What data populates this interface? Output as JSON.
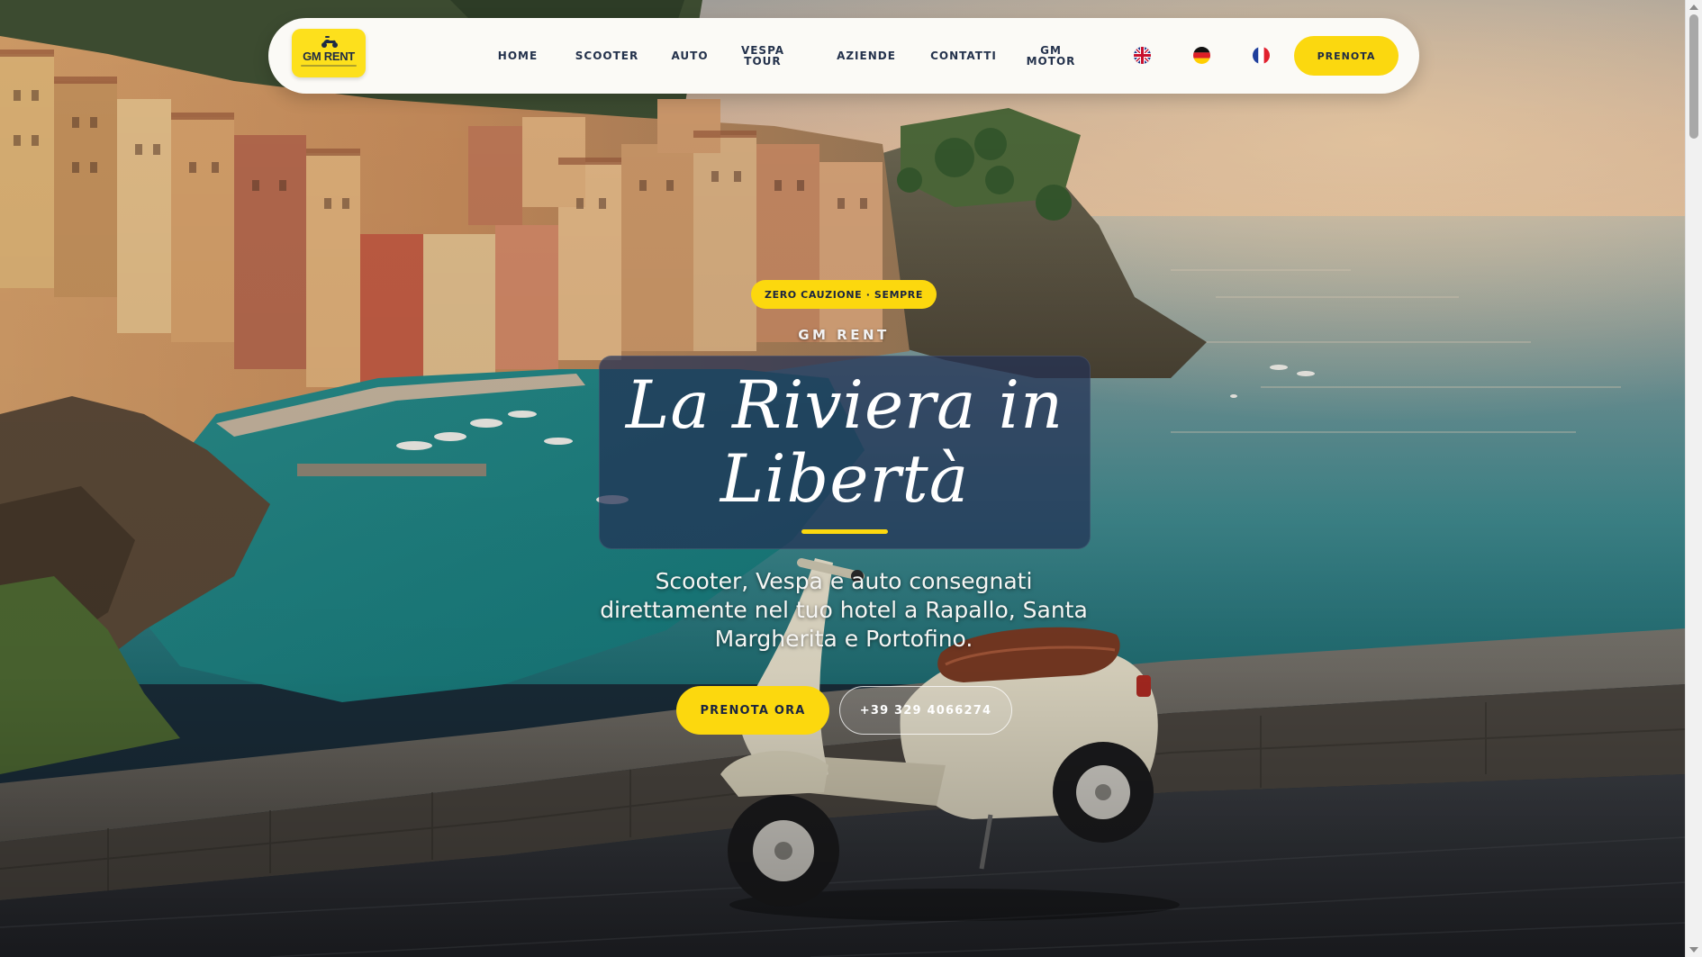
{
  "colors": {
    "accent": "#fcd80e",
    "navy": "#1e2b45",
    "navbar_bg": "#fbfaf6",
    "title_panel": "#223054"
  },
  "hero_image": "Riviera harbour town at sunset with a cream vintage scooter parked on a stone seafront wall",
  "logo": {
    "text": "GM RENT",
    "icon": "scooter-icon"
  },
  "nav": {
    "links": [
      {
        "label": "HOME"
      },
      {
        "label": "SCOOTER"
      },
      {
        "label": "AUTO"
      },
      {
        "label": "VESPA\nTOUR"
      },
      {
        "label": "AZIENDE"
      },
      {
        "label": "CONTATTI"
      },
      {
        "label": "GM\nMOTOR"
      }
    ],
    "languages": [
      {
        "icon": "uk-flag-icon"
      },
      {
        "icon": "germany-flag-icon"
      },
      {
        "icon": "france-flag-icon"
      }
    ],
    "cta_label": "PRENOTA"
  },
  "hero": {
    "badge": "ZERO CAUZIONE · SEMPRE",
    "brand": "GM RENT",
    "title": "La Riviera in Libertà",
    "subtitle": "Scooter, Vespa e auto consegnati direttamente nel tuo hotel a Rapallo, Santa Margherita e Portofino.",
    "primary_button": "PRENOTA ORA",
    "secondary_button": "+39 329 4066274"
  }
}
